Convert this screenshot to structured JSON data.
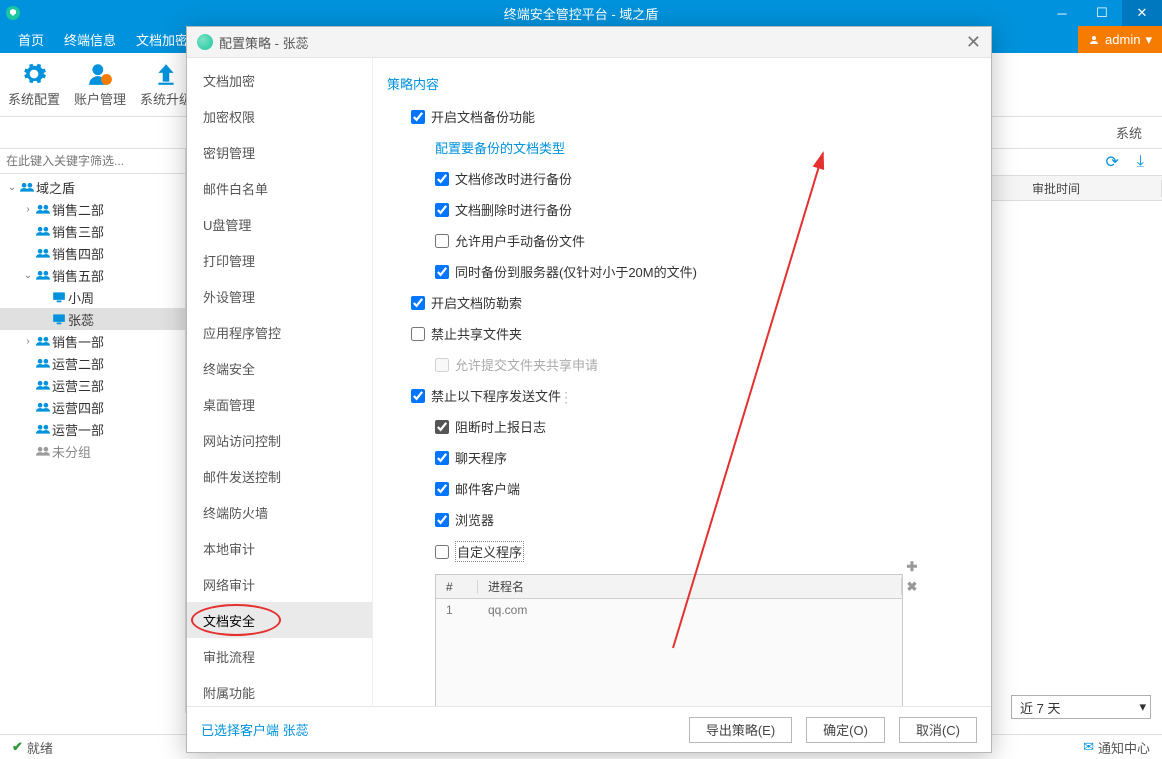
{
  "titlebar": {
    "app": "终端安全管控平台",
    "sub": "域之盾"
  },
  "menubar": {
    "items": [
      "首页",
      "终端信息",
      "文档加密"
    ],
    "admin": "admin"
  },
  "toolbar": {
    "sys_config": "系统配置",
    "acct_mgmt": "账户管理",
    "sys_upgrade": "系统升级"
  },
  "subbar": {
    "label": "系统"
  },
  "filter_placeholder": "在此键入关键字筛选...",
  "tree": {
    "root": "域之盾",
    "groups": [
      "销售二部",
      "销售三部",
      "销售四部",
      "销售五部",
      "销售一部",
      "运营二部",
      "运营三部",
      "运营四部",
      "运营一部",
      "未分组"
    ],
    "sub5": [
      "小周",
      "张蕊"
    ]
  },
  "cols": {
    "approve_time": "审批时间"
  },
  "combo": {
    "value": "近 7 天"
  },
  "status": {
    "ready": "就绪",
    "notif": "通知中心"
  },
  "dialog": {
    "title_prefix": "配置策略",
    "title_target": "张蕊",
    "nav": [
      "文档加密",
      "加密权限",
      "密钥管理",
      "邮件白名单",
      "U盘管理",
      "打印管理",
      "外设管理",
      "应用程序管控",
      "终端安全",
      "桌面管理",
      "网站访问控制",
      "邮件发送控制",
      "终端防火墙",
      "本地审计",
      "网络审计",
      "文档安全",
      "审批流程",
      "附属功能"
    ],
    "content_header": "策略内容",
    "opts": {
      "backup_enable": "开启文档备份功能",
      "config_types": "配置要备份的文档类型",
      "backup_on_modify": "文档修改时进行备份",
      "backup_on_delete": "文档删除时进行备份",
      "allow_manual": "允许用户手动备份文件",
      "backup_server": "同时备份到服务器(仅针对小于20M的文件)",
      "ransom": "开启文档防勒索",
      "deny_share": "禁止共享文件夹",
      "allow_share_apply": "允许提交文件夹共享申请",
      "deny_send": "禁止以下程序发送文件",
      "log_on_block": "阻断时上报日志",
      "chat": "聊天程序",
      "mail_client": "邮件客户端",
      "browser": "浏览器",
      "custom": "自定义程序"
    },
    "table": {
      "col_idx": "#",
      "col_name": "进程名",
      "rows": [
        {
          "idx": "1",
          "name": "qq.com"
        }
      ]
    },
    "footer": {
      "selected": "已选择客户端",
      "target": "张蕊",
      "export": "导出策略(E)",
      "ok": "确定(O)",
      "cancel": "取消(C)"
    }
  }
}
